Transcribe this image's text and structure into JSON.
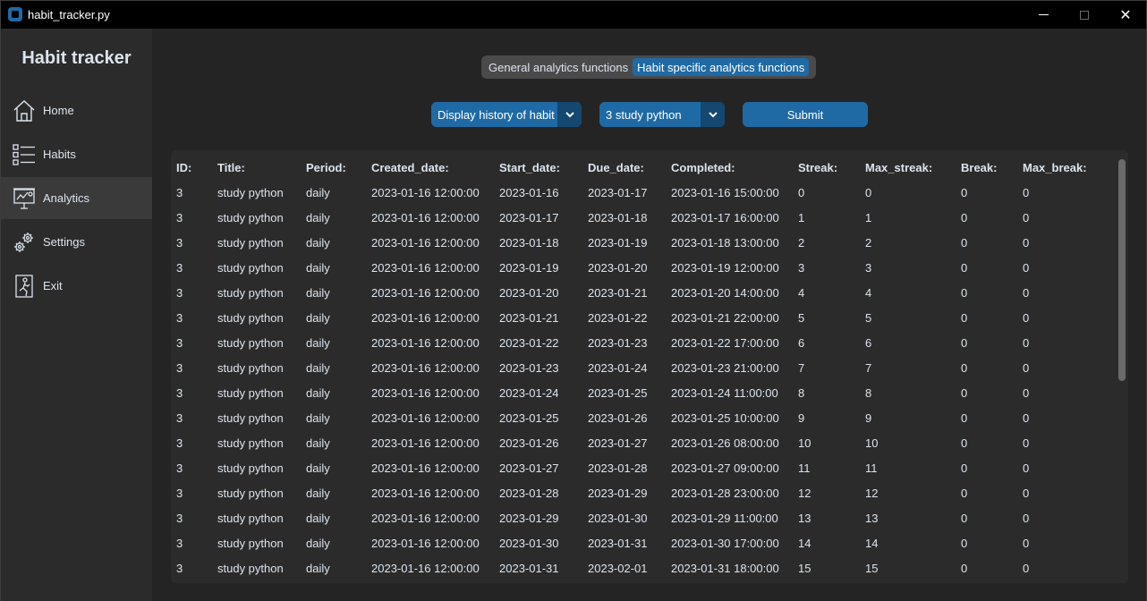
{
  "window": {
    "title": "habit_tracker.py",
    "minimize": "",
    "maximize": "",
    "close": "✕"
  },
  "sidebar": {
    "brand": "Habit tracker",
    "items": [
      {
        "label": "Home",
        "icon": "home-icon"
      },
      {
        "label": "Habits",
        "icon": "checklist-icon"
      },
      {
        "label": "Analytics",
        "icon": "presentation-chart-icon",
        "active": true
      },
      {
        "label": "Settings",
        "icon": "gears-icon"
      },
      {
        "label": "Exit",
        "icon": "exit-door-icon"
      }
    ]
  },
  "tabs": {
    "general": "General analytics functions",
    "habit": "Habit specific analytics functions",
    "selected": "habit"
  },
  "controls": {
    "function_select": "Display history of habit",
    "habit_select": "3 study python",
    "submit": "Submit"
  },
  "table": {
    "headers": [
      "ID:",
      "Title:",
      "Period:",
      "Created_date:",
      "Start_date:",
      "Due_date:",
      "Completed:",
      "Streak:",
      "Max_streak:",
      "Break:",
      "Max_break:"
    ],
    "rows": [
      [
        "3",
        "study python",
        "daily",
        "2023-01-16 12:00:00",
        "2023-01-16",
        "2023-01-17",
        "2023-01-16 15:00:00",
        "0",
        "0",
        "0",
        "0"
      ],
      [
        "3",
        "study python",
        "daily",
        "2023-01-16 12:00:00",
        "2023-01-17",
        "2023-01-18",
        "2023-01-17 16:00:00",
        "1",
        "1",
        "0",
        "0"
      ],
      [
        "3",
        "study python",
        "daily",
        "2023-01-16 12:00:00",
        "2023-01-18",
        "2023-01-19",
        "2023-01-18 13:00:00",
        "2",
        "2",
        "0",
        "0"
      ],
      [
        "3",
        "study python",
        "daily",
        "2023-01-16 12:00:00",
        "2023-01-19",
        "2023-01-20",
        "2023-01-19 12:00:00",
        "3",
        "3",
        "0",
        "0"
      ],
      [
        "3",
        "study python",
        "daily",
        "2023-01-16 12:00:00",
        "2023-01-20",
        "2023-01-21",
        "2023-01-20 14:00:00",
        "4",
        "4",
        "0",
        "0"
      ],
      [
        "3",
        "study python",
        "daily",
        "2023-01-16 12:00:00",
        "2023-01-21",
        "2023-01-22",
        "2023-01-21 22:00:00",
        "5",
        "5",
        "0",
        "0"
      ],
      [
        "3",
        "study python",
        "daily",
        "2023-01-16 12:00:00",
        "2023-01-22",
        "2023-01-23",
        "2023-01-22 17:00:00",
        "6",
        "6",
        "0",
        "0"
      ],
      [
        "3",
        "study python",
        "daily",
        "2023-01-16 12:00:00",
        "2023-01-23",
        "2023-01-24",
        "2023-01-23 21:00:00",
        "7",
        "7",
        "0",
        "0"
      ],
      [
        "3",
        "study python",
        "daily",
        "2023-01-16 12:00:00",
        "2023-01-24",
        "2023-01-25",
        "2023-01-24 11:00:00",
        "8",
        "8",
        "0",
        "0"
      ],
      [
        "3",
        "study python",
        "daily",
        "2023-01-16 12:00:00",
        "2023-01-25",
        "2023-01-26",
        "2023-01-25 10:00:00",
        "9",
        "9",
        "0",
        "0"
      ],
      [
        "3",
        "study python",
        "daily",
        "2023-01-16 12:00:00",
        "2023-01-26",
        "2023-01-27",
        "2023-01-26 08:00:00",
        "10",
        "10",
        "0",
        "0"
      ],
      [
        "3",
        "study python",
        "daily",
        "2023-01-16 12:00:00",
        "2023-01-27",
        "2023-01-28",
        "2023-01-27 09:00:00",
        "11",
        "11",
        "0",
        "0"
      ],
      [
        "3",
        "study python",
        "daily",
        "2023-01-16 12:00:00",
        "2023-01-28",
        "2023-01-29",
        "2023-01-28 23:00:00",
        "12",
        "12",
        "0",
        "0"
      ],
      [
        "3",
        "study python",
        "daily",
        "2023-01-16 12:00:00",
        "2023-01-29",
        "2023-01-30",
        "2023-01-29 11:00:00",
        "13",
        "13",
        "0",
        "0"
      ],
      [
        "3",
        "study python",
        "daily",
        "2023-01-16 12:00:00",
        "2023-01-30",
        "2023-01-31",
        "2023-01-30 17:00:00",
        "14",
        "14",
        "0",
        "0"
      ],
      [
        "3",
        "study python",
        "daily",
        "2023-01-16 12:00:00",
        "2023-01-31",
        "2023-02-01",
        "2023-01-31 18:00:00",
        "15",
        "15",
        "0",
        "0"
      ]
    ]
  },
  "colors": {
    "accent": "#1f6aa5",
    "accent_dark": "#144870",
    "sidebar": "#2b2b2b",
    "background": "#242424",
    "text": "#dce4ee"
  }
}
